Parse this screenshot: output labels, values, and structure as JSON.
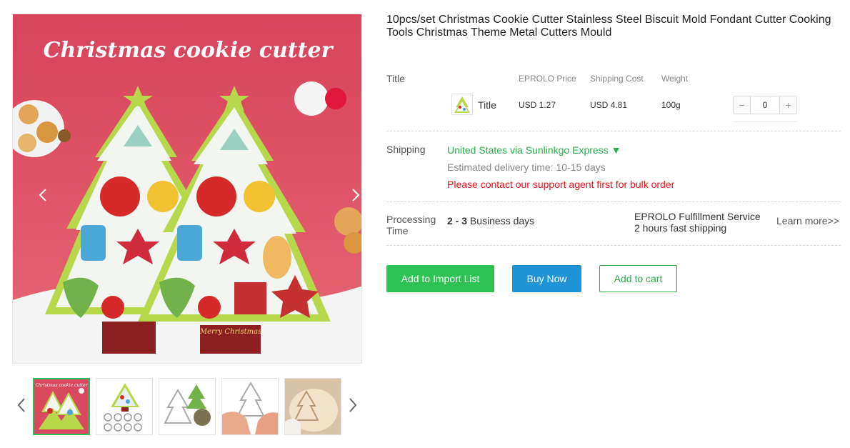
{
  "product": {
    "title": "10pcs/set Christmas Cookie Cutter Stainless Steel Biscuit Mold Fondant Cutter Cooking Tools Christmas Theme Metal Cutters Mould",
    "image_banner_text": "Christmas cookie cutter",
    "image_tag_text": "Merry Christmas"
  },
  "gallery": {
    "thumb_count": 5,
    "active_index": 0,
    "thumb1_text": "Christmas cookie cutter"
  },
  "variants": {
    "label": "Title",
    "headers": {
      "price": "EPROLO Price",
      "shipping": "Shipping Cost",
      "weight": "Weight"
    },
    "rows": [
      {
        "name": "Title",
        "price": "USD 1.27",
        "shipping": "USD 4.81",
        "weight": "100g",
        "quantity": "0"
      }
    ]
  },
  "shipping": {
    "label": "Shipping",
    "method": "United States via Sunlinkgo Express ▼",
    "estimate": "Estimated delivery time: 10-15 days",
    "warning": "Please contact our support agent first for bulk order"
  },
  "processing": {
    "label": "Processing Time",
    "days_bold": "2 - 3",
    "days_text": " Business days",
    "service_line1": "EPROLO Fulfillment Service",
    "service_line2": "2 hours fast shipping",
    "learn_more": "Learn more>>"
  },
  "actions": {
    "import_label": "Add to Import List",
    "buy_label": "Buy Now",
    "cart_label": "Add to cart"
  },
  "colors": {
    "accent_green": "#2ec154",
    "buy_blue": "#1f93d6",
    "warning_red": "#e5141a",
    "image_bg": "#d94a5e"
  },
  "icons": {
    "gallery_prev": "chevron-left-icon",
    "gallery_next": "chevron-right-icon",
    "stepper_minus": "minus-icon",
    "stepper_plus": "plus-icon"
  }
}
